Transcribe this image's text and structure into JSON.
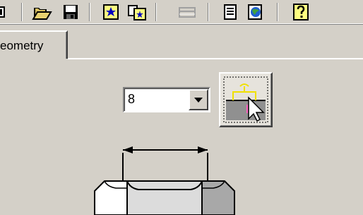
{
  "toolbar": {
    "buttons": [
      {
        "icon": "partial-button-icon"
      },
      {
        "icon": "open-folder-icon"
      },
      {
        "icon": "save-disk-icon"
      },
      {
        "icon": "new-star-icon"
      },
      {
        "icon": "dialog-icon"
      },
      {
        "icon": "table-disabled-icon"
      },
      {
        "icon": "document-icon"
      },
      {
        "icon": "web-globe-icon"
      },
      {
        "icon": "help-icon"
      }
    ]
  },
  "tabs": [
    {
      "label": "eometry",
      "active": true
    }
  ],
  "size_combo": {
    "value": "8"
  },
  "pick_button": {
    "icon": "pick-size-icon"
  },
  "drawing": {
    "subject": "hex-nut-icon"
  }
}
